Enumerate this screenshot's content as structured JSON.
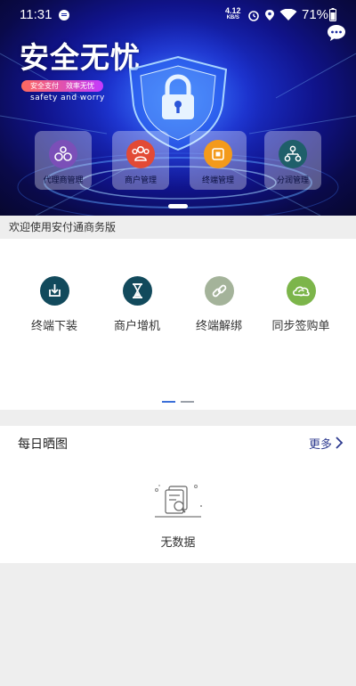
{
  "status_bar": {
    "time": "11:31",
    "speed_value": "4.12",
    "speed_unit": "KB/S",
    "battery": "71%"
  },
  "banner": {
    "title": "安全无忧",
    "slogan": "安全支付　效率无忧",
    "slogan_sub": "safety and worry",
    "cards": [
      {
        "label": "代理商管理",
        "icon": "agent-network-icon",
        "color": "#7b4fb8"
      },
      {
        "label": "商户管理",
        "icon": "merchant-group-icon",
        "color": "#e24a35"
      },
      {
        "label": "终端管理",
        "icon": "terminal-chip-icon",
        "color": "#f39a1b"
      },
      {
        "label": "分润管理",
        "icon": "profit-share-icon",
        "color": "#1f5f6a"
      }
    ]
  },
  "welcome_text": "欢迎使用安付通商务版",
  "actions": [
    {
      "label": "终端下装",
      "icon": "download-box-icon",
      "color": "#124a5c"
    },
    {
      "label": "商户增机",
      "icon": "hourglass-icon",
      "color": "#124a5c"
    },
    {
      "label": "终端解绑",
      "icon": "unlink-chain-icon",
      "color": "#a4b39a"
    },
    {
      "label": "同步签购单",
      "icon": "sync-cloud-icon",
      "color": "#7cb54a"
    }
  ],
  "daily": {
    "title": "每日晒图",
    "more": "更多",
    "empty": "无数据"
  },
  "colors": {
    "accent": "#2d3a8f",
    "pager_active": "#3b6fd8",
    "pager_inactive": "#9aa0a8"
  }
}
